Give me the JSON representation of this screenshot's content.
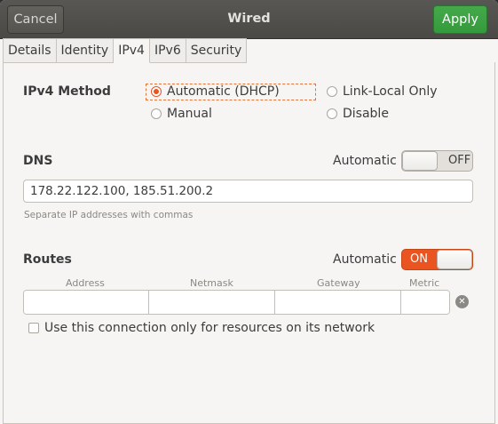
{
  "header": {
    "title": "Wired",
    "cancel_label": "Cancel",
    "apply_label": "Apply"
  },
  "tabs": [
    {
      "label": "Details",
      "active": false
    },
    {
      "label": "Identity",
      "active": false
    },
    {
      "label": "IPv4",
      "active": true
    },
    {
      "label": "IPv6",
      "active": false
    },
    {
      "label": "Security",
      "active": false
    }
  ],
  "ipv4_method": {
    "label": "IPv4 Method",
    "options": [
      {
        "label": "Automatic (DHCP)",
        "checked": true
      },
      {
        "label": "Link-Local Only",
        "checked": false
      },
      {
        "label": "Manual",
        "checked": false
      },
      {
        "label": "Disable",
        "checked": false
      }
    ]
  },
  "dns": {
    "label": "DNS",
    "automatic_label": "Automatic",
    "switch_state": "OFF",
    "value": "178.22.122.100, 185.51.200.2",
    "hint": "Separate IP addresses with commas"
  },
  "routes": {
    "label": "Routes",
    "automatic_label": "Automatic",
    "switch_state": "ON",
    "columns": [
      "Address",
      "Netmask",
      "Gateway",
      "Metric"
    ],
    "only_local_label": "Use this connection only for resources on its network"
  },
  "colors": {
    "accent": "#e95420",
    "apply_green": "#3aa140",
    "header_bg": "#4f4e4a"
  }
}
